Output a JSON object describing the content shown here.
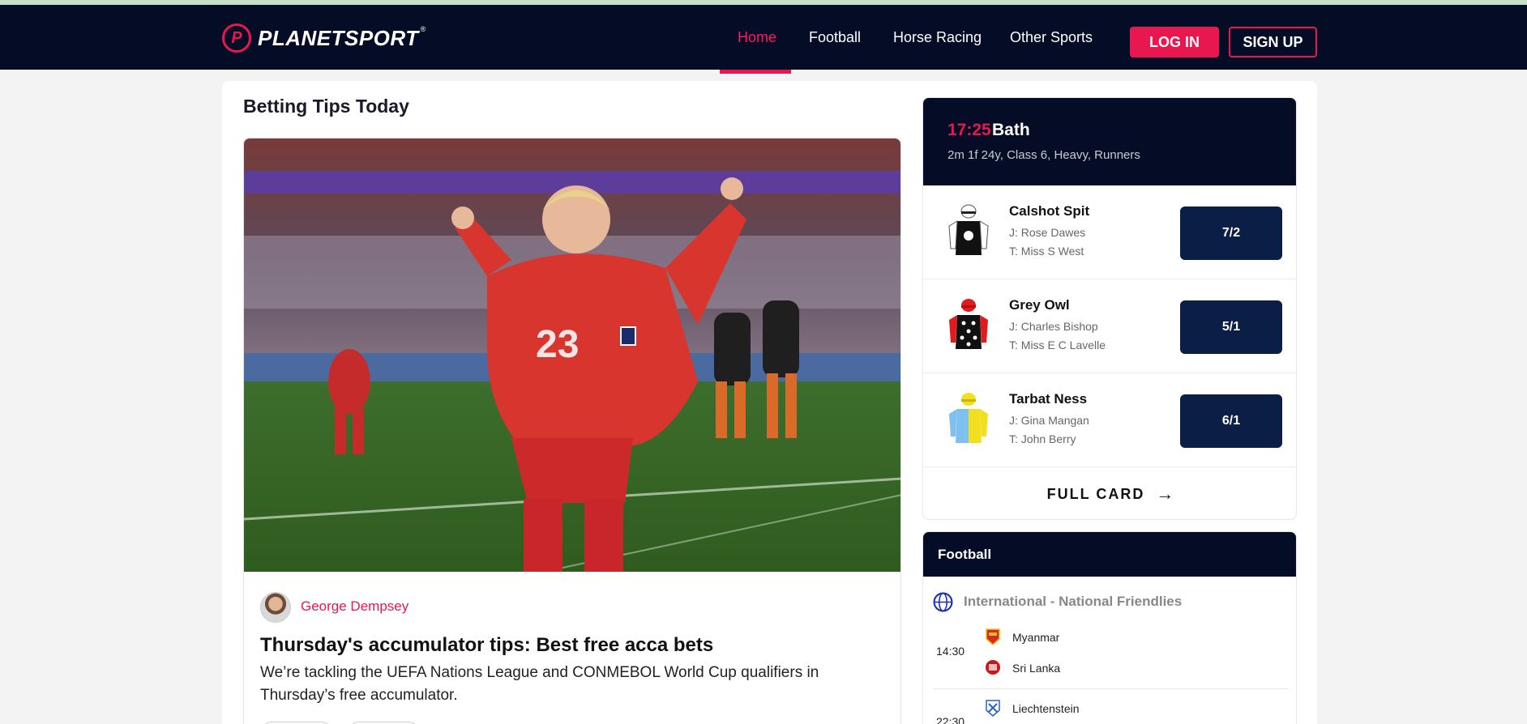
{
  "header": {
    "logo_text": "PLANETSPORT",
    "logo_mark": "P",
    "logo_reg": "®",
    "nav": [
      {
        "label": "Home",
        "active": true
      },
      {
        "label": "Football"
      },
      {
        "label": "Horse Racing"
      },
      {
        "label": "Other Sports"
      }
    ],
    "login_label": "LOG IN",
    "signup_label": "SIGN UP"
  },
  "colors": {
    "brand_pink": "#e8174f",
    "navy": "#050d26",
    "odds_navy": "#0b1e45"
  },
  "main": {
    "section_title": "Betting Tips Today",
    "article": {
      "author": "George Dempsey",
      "title": "Thursday's accumulator tips: Best free acca bets",
      "description": "We’re tackling the UEFA Nations League and CONMEBOL World Cup qualifiers in Thursday’s free accumulator."
    }
  },
  "race": {
    "time": "17:25",
    "venue": "Bath",
    "meta": "2m 1f 24y, Class 6, Heavy, Runners",
    "runners": [
      {
        "name": "Calshot Spit",
        "jockey": "J: Rose Dawes",
        "trainer": "T: Miss S West",
        "odds": "7/2"
      },
      {
        "name": "Grey Owl",
        "jockey": "J: Charles Bishop",
        "trainer": "T: Miss E C Lavelle",
        "odds": "5/1"
      },
      {
        "name": "Tarbat Ness",
        "jockey": "J: Gina Mangan",
        "trainer": "T: John Berry",
        "odds": "6/1"
      }
    ],
    "full_card_label": "FULL CARD",
    "full_card_arrow": "→"
  },
  "football": {
    "heading": "Football",
    "competition": "International - National Friendlies",
    "matches": [
      {
        "time": "14:30",
        "home": "Myanmar",
        "away": "Sri Lanka"
      },
      {
        "time": "22:30",
        "home": "Liechtenstein",
        "away": ""
      }
    ]
  }
}
